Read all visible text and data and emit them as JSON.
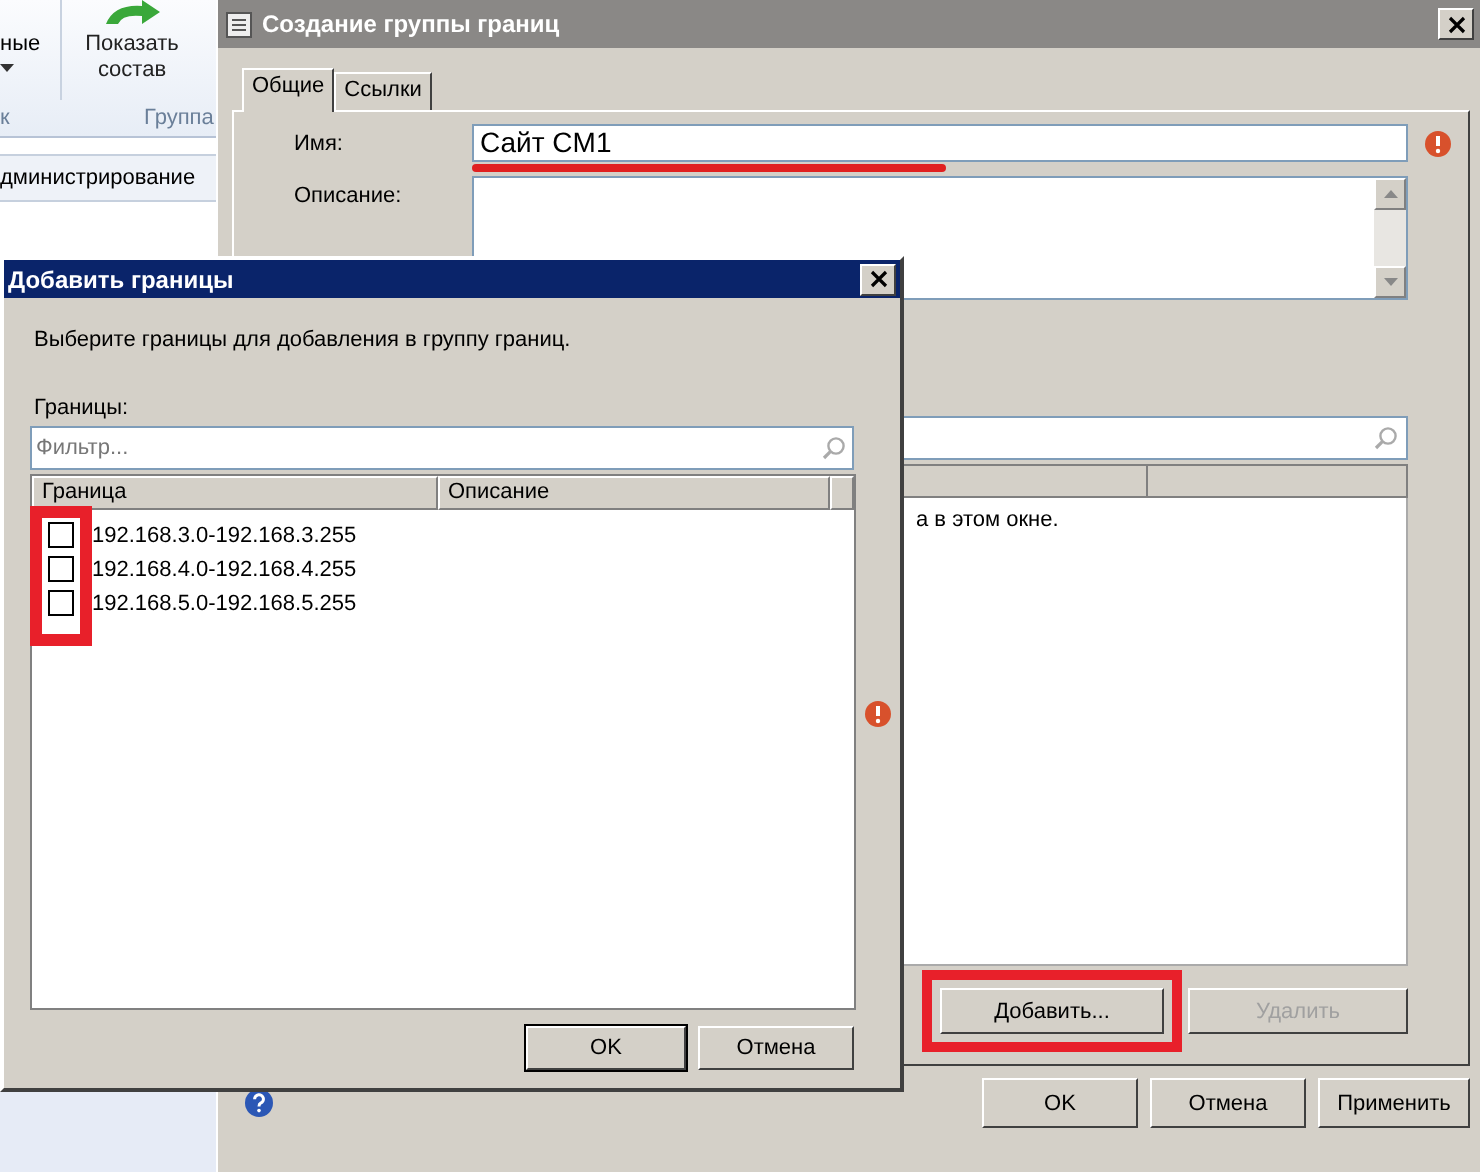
{
  "background_app": {
    "ribbon_items": [
      {
        "kind": "dropdown",
        "label": "ные"
      },
      {
        "kind": "button",
        "label": "Показать состав"
      }
    ],
    "groups": [
      "к",
      "Группа"
    ],
    "tab": "дминистрирование"
  },
  "main_dialog": {
    "title": "Создание группы границ",
    "tabs": [
      {
        "label": "Общие",
        "selected": true
      },
      {
        "label": "Ссылки",
        "selected": false
      }
    ],
    "name_label": "Имя:",
    "name_value": "Сайт CM1",
    "name_underlined": true,
    "name_error": true,
    "description_label": "Описание:",
    "list_message": "а в этом окне.",
    "add_button": {
      "label": "Добавить...",
      "highlighted": true,
      "disabled": false
    },
    "remove_button": {
      "label": "Удалить",
      "disabled": true
    },
    "buttons": [
      "OK",
      "Отмена",
      "Применить"
    ]
  },
  "sub_dialog": {
    "title": "Добавить границы",
    "instruction": "Выберите границы для добавления в группу границ.",
    "list_label": "Границы:",
    "filter_placeholder": "Фильтр...",
    "columns": [
      "Граница",
      "Описание"
    ],
    "rows": [
      {
        "range": "192.168.3.0-192.168.3.255",
        "checked": false
      },
      {
        "range": "192.168.4.0-192.168.4.255",
        "checked": false
      },
      {
        "range": "192.168.5.0-192.168.5.255",
        "checked": false
      }
    ],
    "checkboxes_highlighted": true,
    "error": true,
    "buttons": [
      "OK",
      "Отмена"
    ]
  }
}
